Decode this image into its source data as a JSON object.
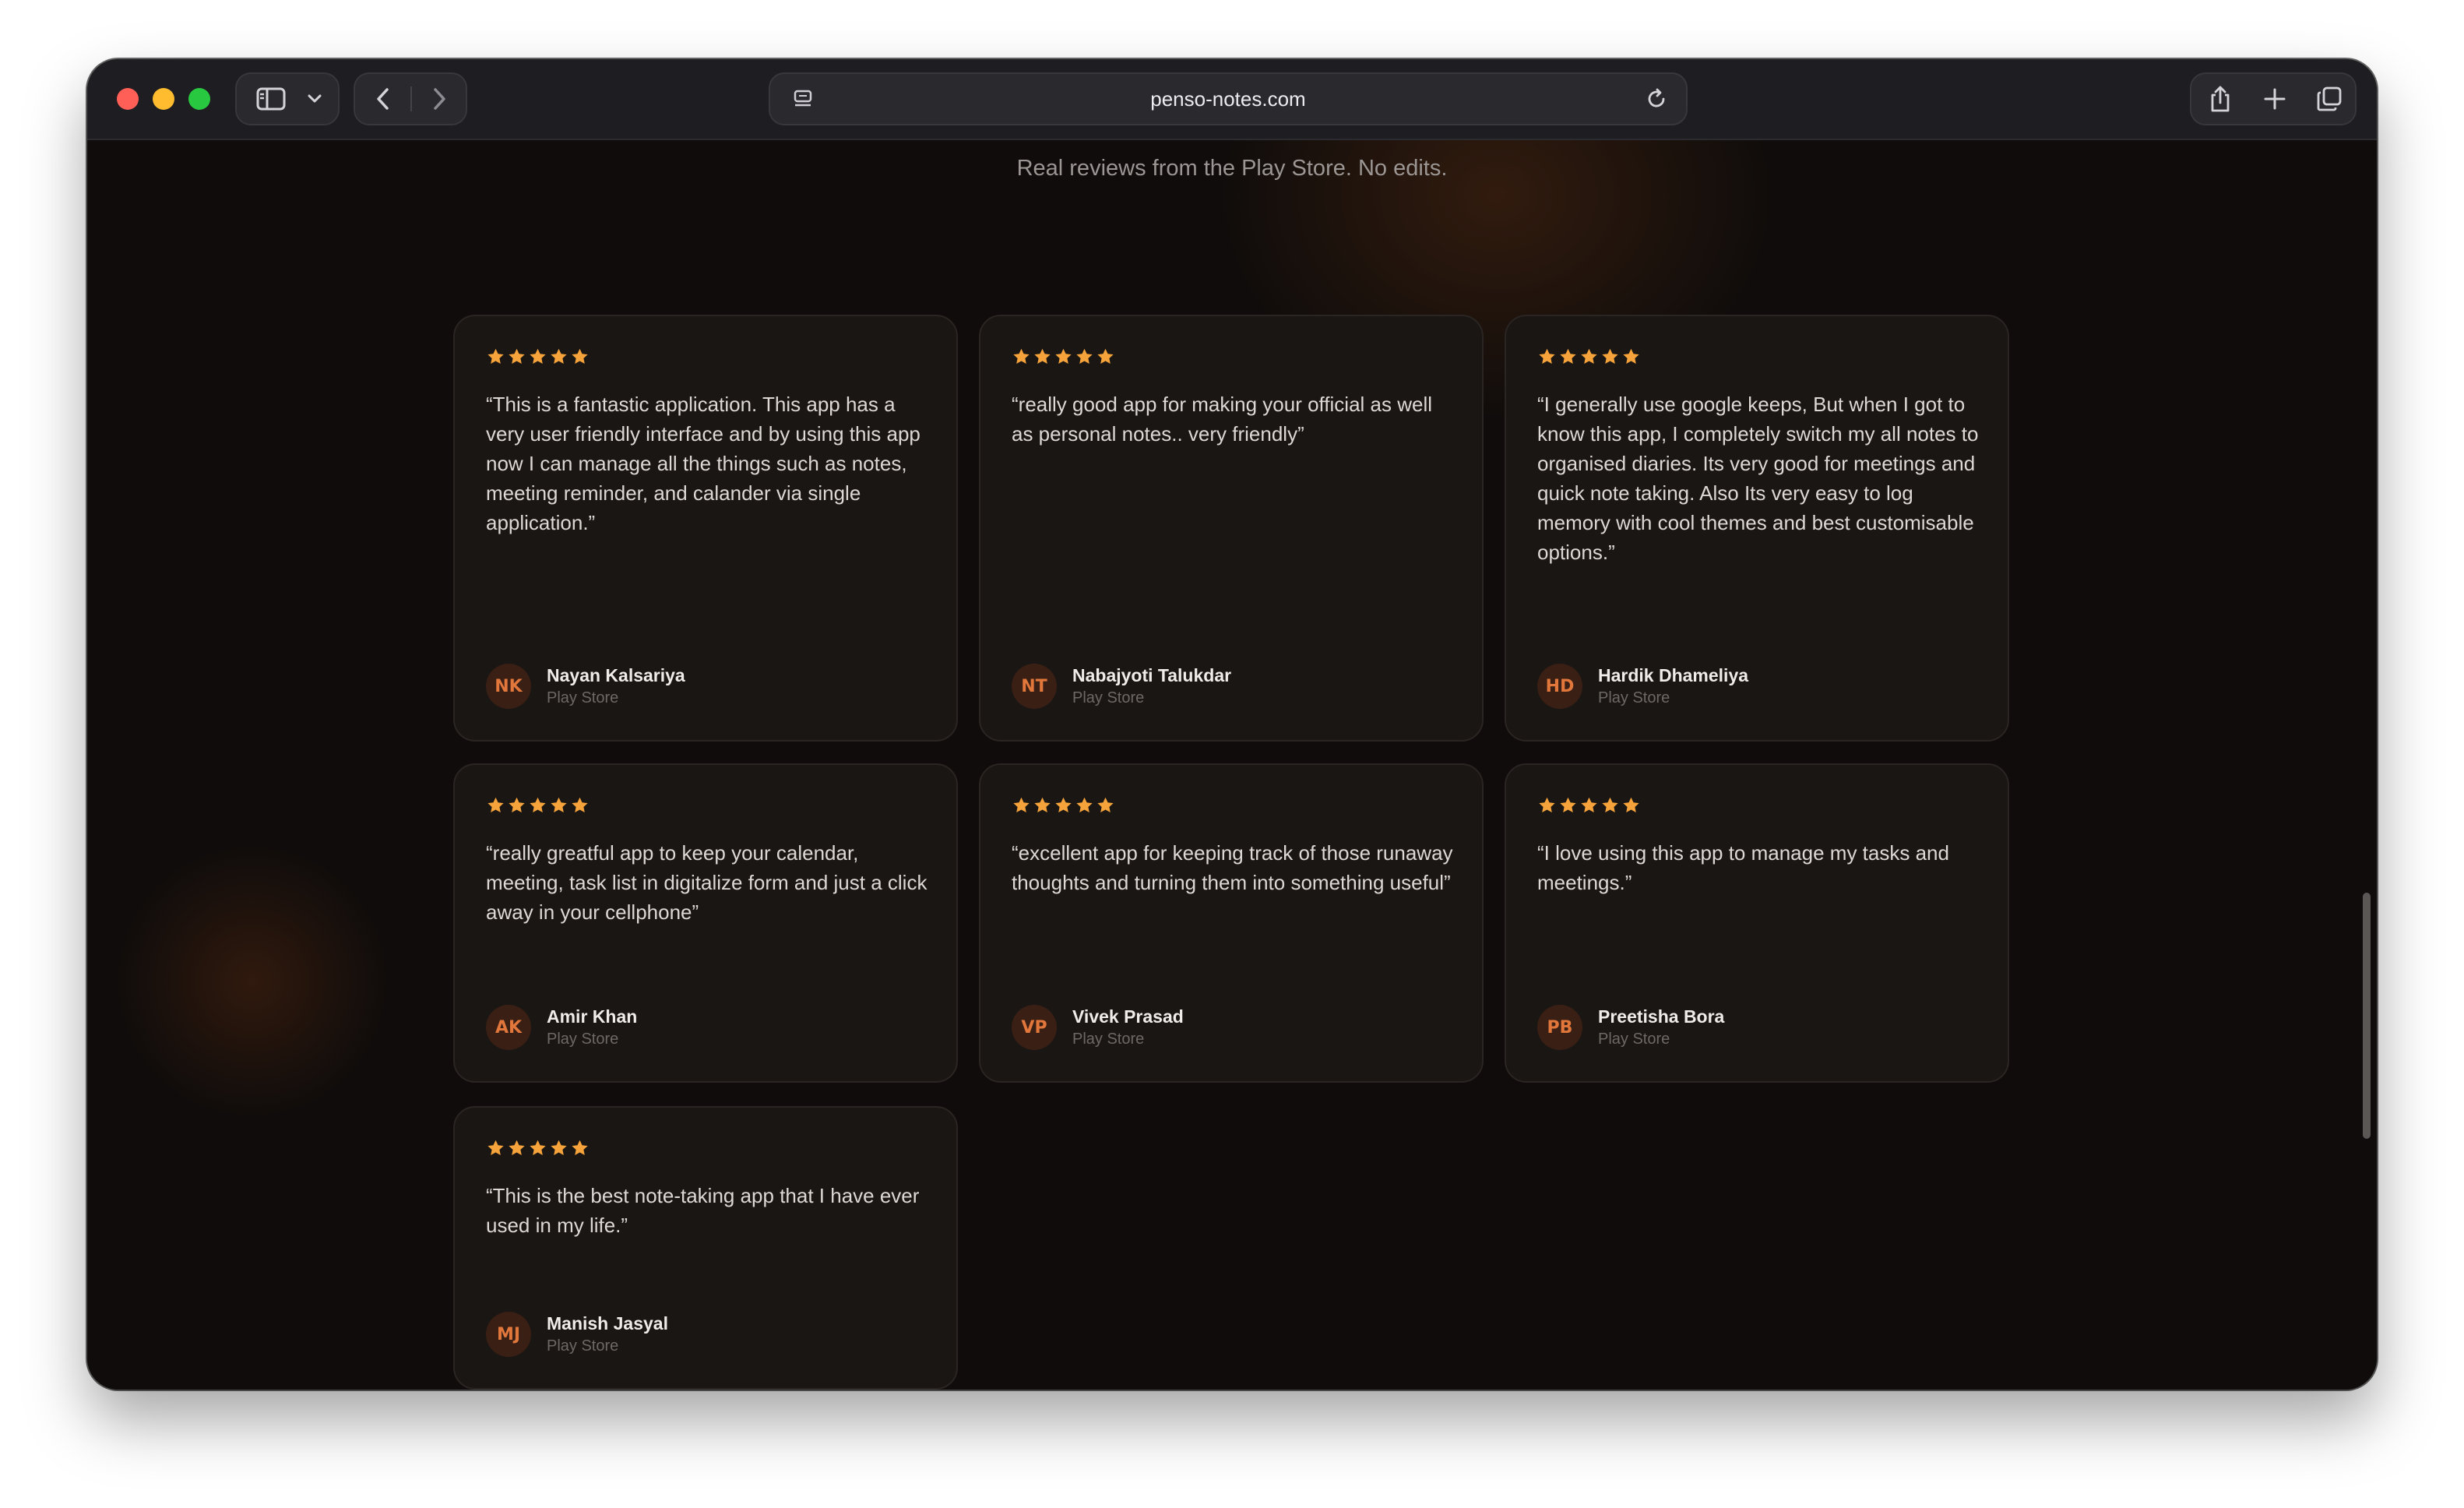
{
  "browser": {
    "url": "penso-notes.com"
  },
  "page": {
    "subtitle": "Real reviews from the Play Store. No edits."
  },
  "colors": {
    "star": "#f5a33a",
    "accent": "#e2773c"
  },
  "reviews": [
    {
      "rating": 5,
      "quote": "“This is a fantastic application. This app has a very user friendly interface and by using this app now I can manage all the things such as notes, meeting reminder, and calander via single application.”",
      "initials": "NK",
      "name": "Nayan Kalsariya",
      "source": "Play Store"
    },
    {
      "rating": 5,
      "quote": "“really good app for making your official as well as personal notes.. very friendly”",
      "initials": "NT",
      "name": "Nabajyoti Talukdar",
      "source": "Play Store"
    },
    {
      "rating": 5,
      "quote": "“I generally use google keeps, But when I got to know this app, I completely switch my all notes to organised diaries. Its very good for meetings and quick note taking. Also Its very easy to log memory with cool themes and best customisable options.”",
      "initials": "HD",
      "name": "Hardik Dhameliya",
      "source": "Play Store"
    },
    {
      "rating": 5,
      "quote": "“really greatful app to keep your calendar, meeting, task list in digitalize form and just a click away in your cellphone”",
      "initials": "AK",
      "name": "Amir Khan",
      "source": "Play Store"
    },
    {
      "rating": 5,
      "quote": "“excellent app for keeping track of those runaway thoughts and turning them into something useful”",
      "initials": "VP",
      "name": "Vivek Prasad",
      "source": "Play Store"
    },
    {
      "rating": 5,
      "quote": "“I love using this app to manage my tasks and meetings.”",
      "initials": "PB",
      "name": "Preetisha Bora",
      "source": "Play Store"
    },
    {
      "rating": 5,
      "quote": "“This is the best note-taking app that I have ever used in my life.”",
      "initials": "MJ",
      "name": "Manish Jasyal",
      "source": "Play Store"
    }
  ]
}
